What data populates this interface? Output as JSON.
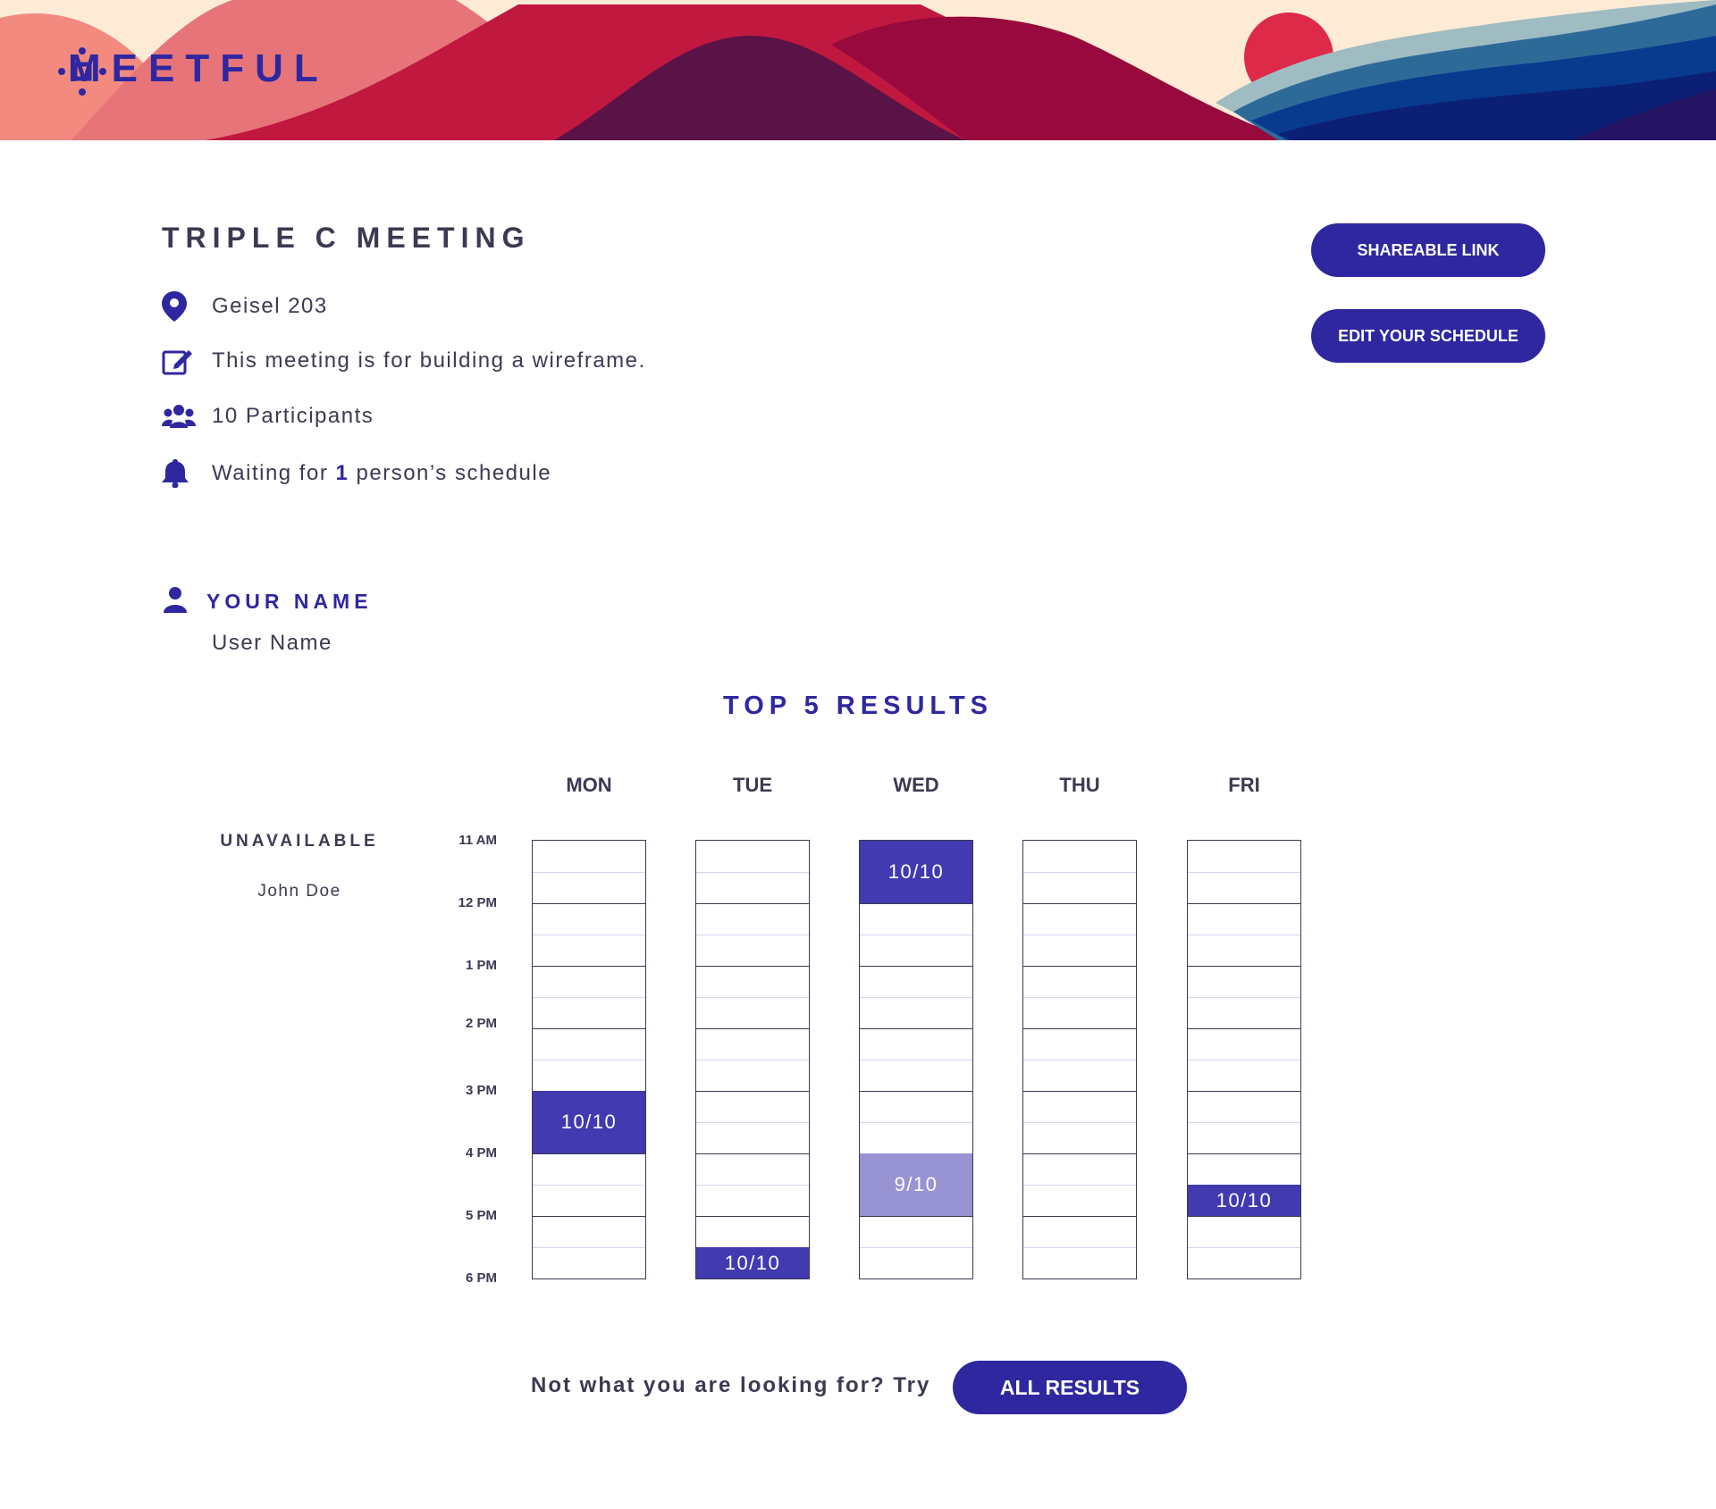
{
  "brand": {
    "name": "MEETFUL",
    "accent": "#2e27a0"
  },
  "meeting": {
    "title": "TRIPLE C MEETING",
    "location": "Geisel 203",
    "description": "This meeting is for building a wireframe.",
    "participants": "10 Participants",
    "waiting_prefix": "Waiting for",
    "waiting_count": "1",
    "waiting_suffix": "person’s schedule"
  },
  "actions": {
    "shareable_link": "SHAREABLE LINK",
    "edit_schedule": "EDIT YOUR SCHEDULE"
  },
  "user": {
    "label": "YOUR NAME",
    "name": "User Name"
  },
  "results": {
    "title": "TOP 5 RESULTS",
    "unavailable_label": "UNAVAILABLE",
    "unavailable_people": [
      "John Doe"
    ],
    "time_labels": [
      "11 AM",
      "12 PM",
      "1 PM",
      "2 PM",
      "3 PM",
      "4 PM",
      "5 PM",
      "6 PM"
    ],
    "days": [
      "MON",
      "TUE",
      "WED",
      "THU",
      "FRI"
    ],
    "slots": [
      {
        "day": "MON",
        "start": "3 PM",
        "end": "4 PM",
        "label": "10/10",
        "level": "full"
      },
      {
        "day": "TUE",
        "start": "5:30 PM",
        "end": "6 PM",
        "label": "10/10",
        "level": "full"
      },
      {
        "day": "WED",
        "start": "11 AM",
        "end": "12 PM",
        "label": "10/10",
        "level": "full"
      },
      {
        "day": "WED",
        "start": "4 PM",
        "end": "5 PM",
        "label": "9/10",
        "level": "partial"
      },
      {
        "day": "FRI",
        "start": "4:30 PM",
        "end": "5 PM",
        "label": "10/10",
        "level": "full"
      }
    ]
  },
  "footer": {
    "prompt": "Not what you are looking for? Try",
    "all_results": "ALL RESULTS"
  },
  "colors": {
    "slot_full": "#423ab0",
    "slot_partial": "#9893d2",
    "text": "#3b3a52"
  }
}
